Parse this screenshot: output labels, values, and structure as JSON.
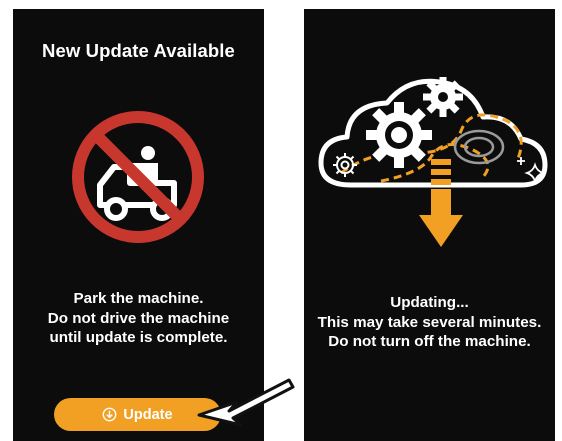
{
  "left_screen": {
    "title": "New Update Available",
    "icon": "no-driving-machine-icon",
    "message_lines": [
      "Park the machine.",
      "Do not drive the machine",
      "until update is complete."
    ],
    "update_button": {
      "label": "Update",
      "icon": "download-icon"
    }
  },
  "right_screen": {
    "icon": "cloud-gears-download-icon",
    "message_lines": [
      "Updating...",
      "This may take several minutes.",
      "Do not turn off the machine."
    ]
  },
  "colors": {
    "screen_bg": "#0c0c0c",
    "accent_orange": "#f1a024",
    "prohibit_red": "#c8372d",
    "text": "#ffffff"
  }
}
